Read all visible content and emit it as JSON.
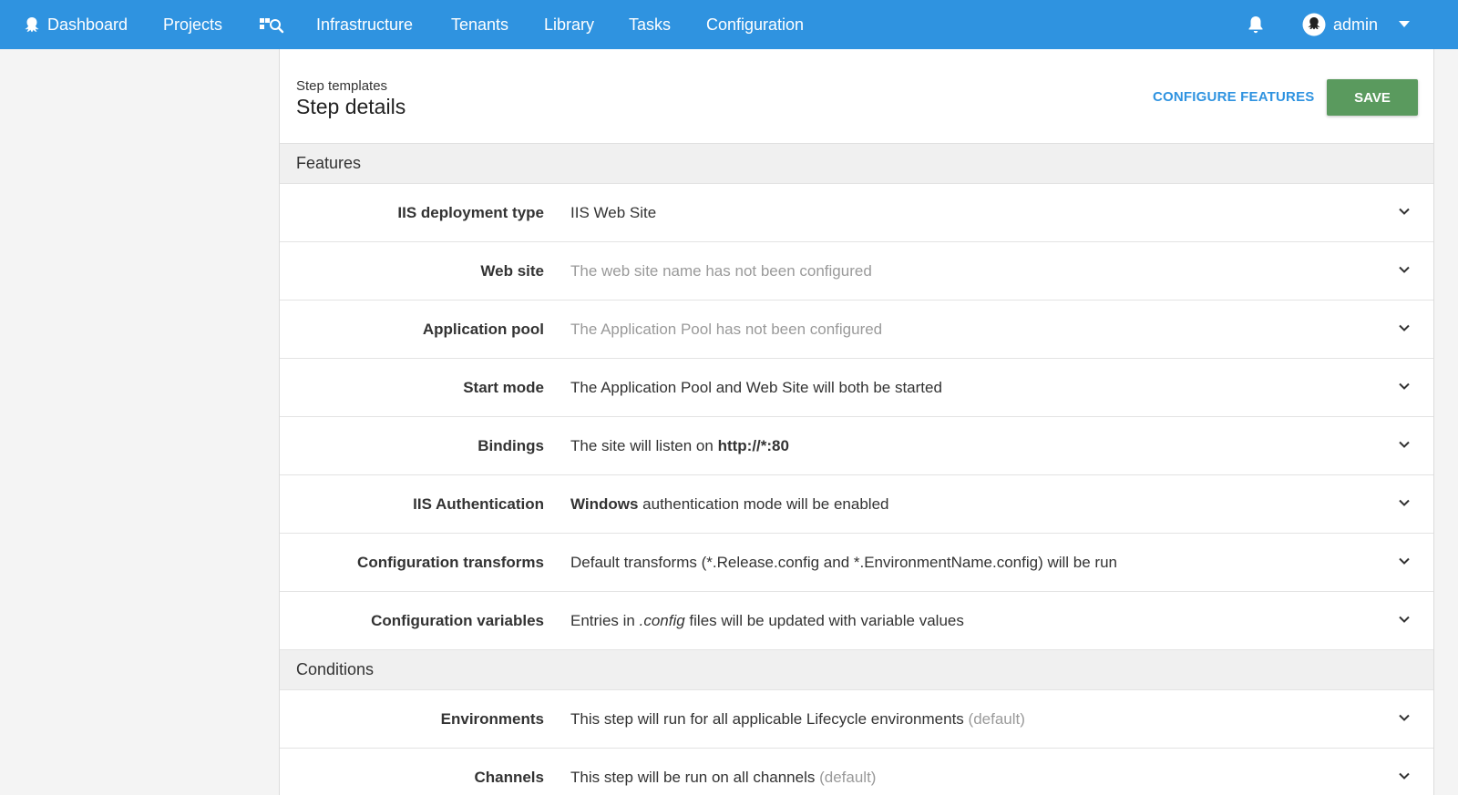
{
  "nav": {
    "dashboard": "Dashboard",
    "projects": "Projects",
    "infrastructure": "Infrastructure",
    "tenants": "Tenants",
    "library": "Library",
    "tasks": "Tasks",
    "configuration": "Configuration",
    "user": "admin",
    "icons": [
      "octopus-icon",
      "search-projects-icon",
      "bell-icon",
      "avatar-icon",
      "caret-down-icon"
    ]
  },
  "header": {
    "breadcrumb": "Step templates",
    "title": "Step details",
    "configure_label": "CONFIGURE FEATURES",
    "save_label": "SAVE"
  },
  "features": {
    "heading": "Features",
    "rows": [
      {
        "label": "IIS deployment type",
        "value": "IIS Web Site"
      },
      {
        "label": "Web site",
        "value": "The web site name has not been configured"
      },
      {
        "label": "Application pool",
        "value": "The Application Pool has not been configured"
      },
      {
        "label": "Start mode",
        "value": "The Application Pool and Web Site will both be started"
      },
      {
        "label": "Bindings",
        "value_pre": "The site will listen on ",
        "value_bold": "http://*:80"
      },
      {
        "label": "IIS Authentication",
        "value_bold": "Windows",
        "value_post": " authentication mode will be enabled"
      },
      {
        "label": "Configuration transforms",
        "value": "Default transforms (*.Release.config and *.EnvironmentName.config) will be run"
      },
      {
        "label": "Configuration variables",
        "value_pre": "Entries in ",
        "value_italic": ".config",
        "value_post": " files will be updated with variable values"
      }
    ]
  },
  "conditions": {
    "heading": "Conditions",
    "rows": [
      {
        "label": "Environments",
        "value": "This step will run for all applicable Lifecycle environments ",
        "value_muted": "(default)"
      },
      {
        "label": "Channels",
        "value": "This step will be run on all channels ",
        "value_muted": "(default)"
      }
    ]
  },
  "colors": {
    "nav_bg": "#2f93e0",
    "save_bg": "#5a9a5e",
    "link": "#2f93e0"
  }
}
